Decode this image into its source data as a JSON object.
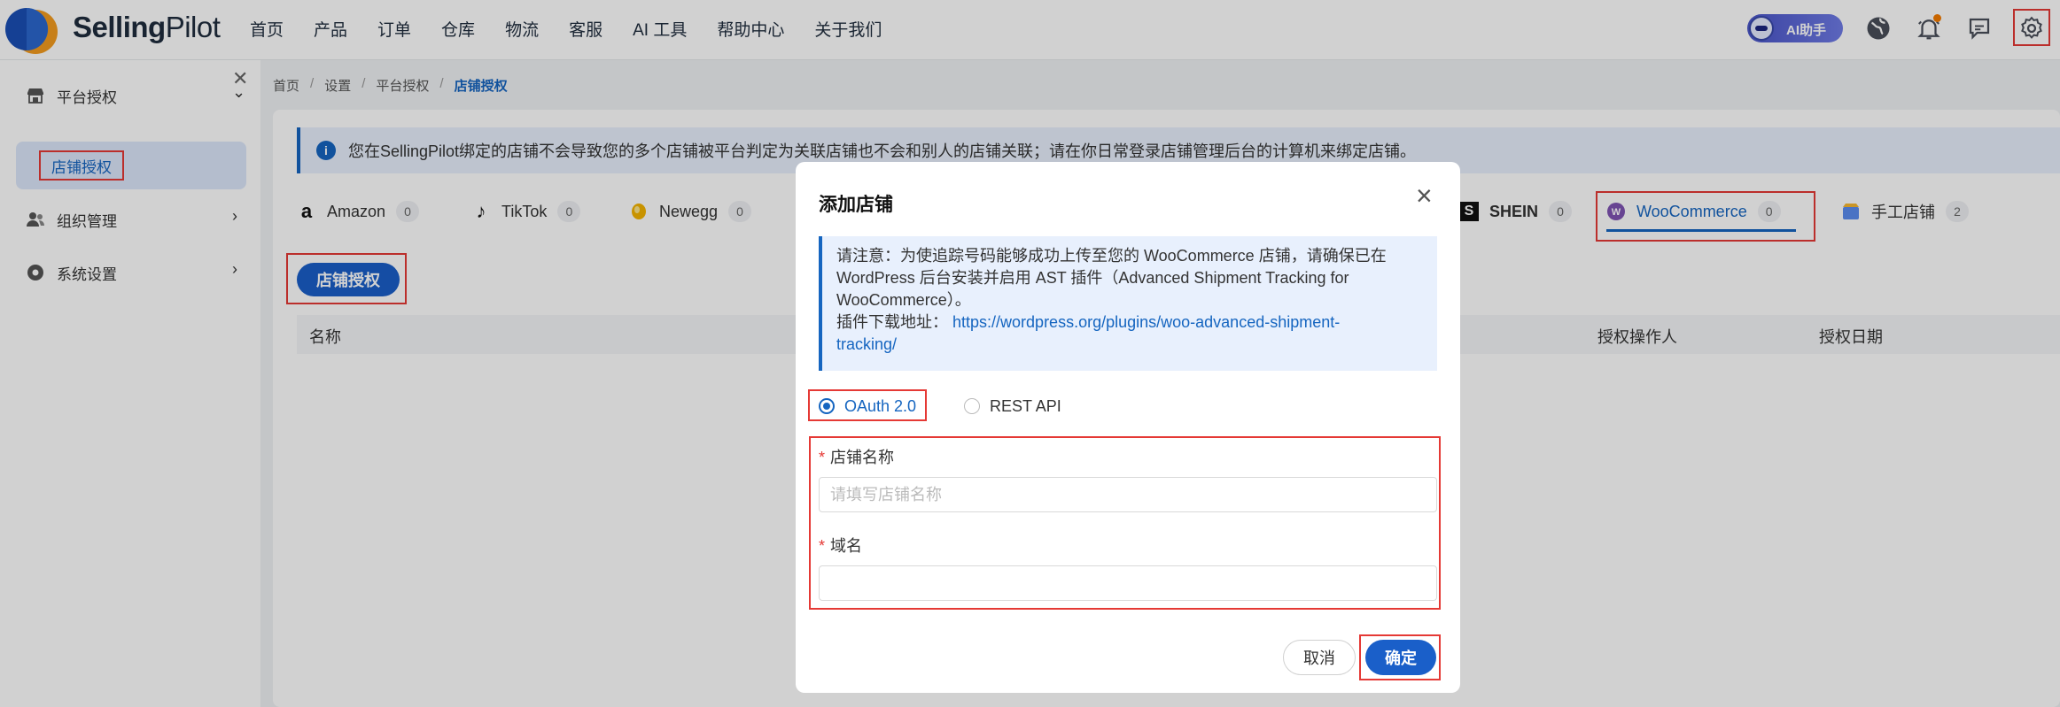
{
  "header": {
    "brand_bold": "Selling",
    "brand_light": "Pilot",
    "nav": [
      "首页",
      "产品",
      "订单",
      "仓库",
      "物流",
      "客服",
      "AI 工具",
      "帮助中心",
      "关于我们"
    ],
    "ai_button": "AI助手",
    "icons": [
      "globe-icon",
      "bell-icon",
      "message-icon",
      "gear-icon"
    ]
  },
  "sidebar": {
    "groups": [
      {
        "label": "平台授权",
        "icon": "store-icon",
        "expanded": true
      },
      {
        "label": "组织管理",
        "icon": "users-icon",
        "expanded": false
      },
      {
        "label": "系统设置",
        "icon": "gear-icon",
        "expanded": false
      }
    ],
    "active_item": "店铺授权"
  },
  "breadcrumb": [
    "首页",
    "设置",
    "平台授权",
    "店铺授权"
  ],
  "notice": "您在SellingPilot绑定的店铺不会导致您的多个店铺被平台判定为关联店铺也不会和别人的店铺关联；请在你日常登录店铺管理后台的计算机来绑定店铺。",
  "tabs": [
    {
      "label": "Amazon",
      "count": "0"
    },
    {
      "label": "TikTok",
      "count": "0"
    },
    {
      "label": "Newegg",
      "count": "0"
    },
    {
      "label": "SHEIN",
      "count": "0"
    },
    {
      "label": "WooCommerce",
      "count": "0",
      "active": true
    },
    {
      "label": "手工店铺",
      "count": "2"
    }
  ],
  "auth_button": "店铺授权",
  "table": {
    "columns": [
      "名称",
      "授权操作人",
      "授权日期"
    ]
  },
  "modal": {
    "title": "添加店铺",
    "note_line1": "请注意：为使追踪号码能够成功上传至您的 WooCommerce 店铺，请确保已在",
    "note_line2": "WordPress 后台安装并启用 AST 插件（Advanced Shipment Tracking for",
    "note_line3": "WooCommerce）。",
    "note_download_label": "插件下载地址：",
    "note_link_part1": "https://wordpress.org/plugins/woo-advanced-shipment-",
    "note_link_part2": "tracking/",
    "auth_options": [
      {
        "label": "OAuth 2.0",
        "selected": true
      },
      {
        "label": "REST API",
        "selected": false
      }
    ],
    "fields": [
      {
        "label": "店铺名称",
        "value": "",
        "placeholder": "请填写店铺名称",
        "required": true
      },
      {
        "label": "域名",
        "value": "",
        "placeholder": "",
        "required": true
      }
    ],
    "cancel": "取消",
    "confirm": "确定"
  },
  "colors": {
    "primary": "#1a5fc9",
    "highlight_border": "#e53935",
    "notice_bg": "#e8f0fd"
  }
}
